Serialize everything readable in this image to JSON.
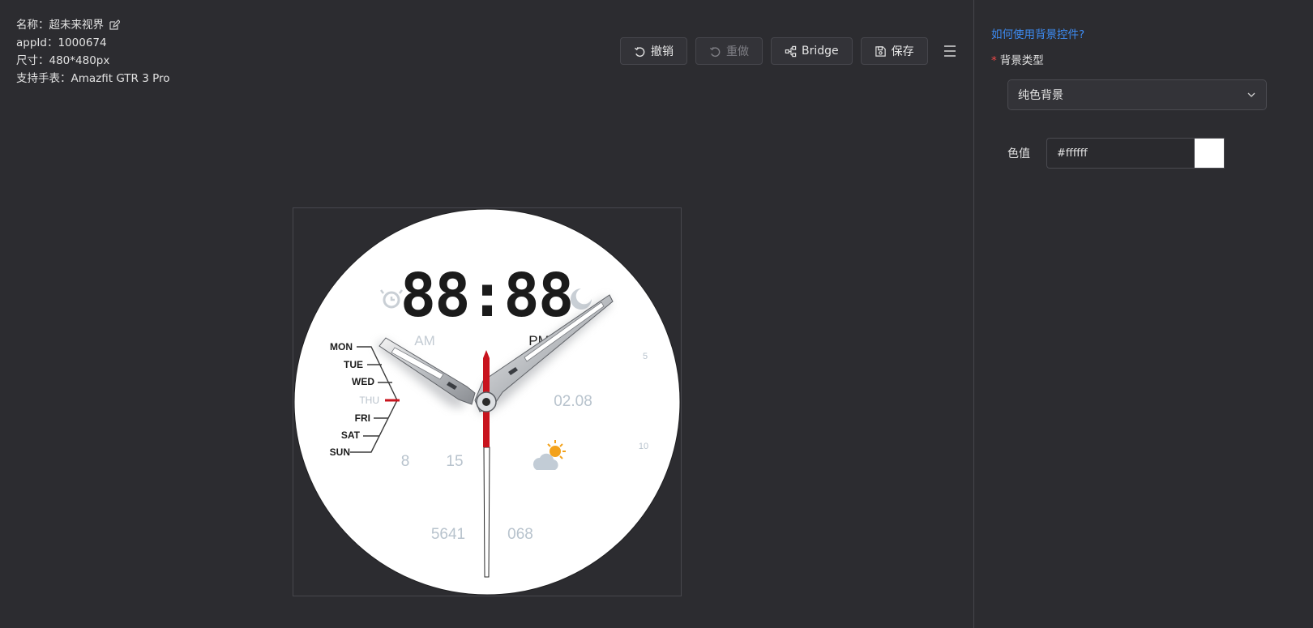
{
  "info": {
    "name": "名称：超未来视界",
    "appid": "appId：1000674",
    "size": "尺寸：480*480px",
    "support": "支持手表：Amazfit GTR 3 Pro"
  },
  "toolbar": {
    "undo_label": "撤销",
    "redo_label": "重做",
    "bridge_label": "Bridge",
    "save_label": "保存"
  },
  "panel": {
    "help_link": "如何使用背景控件?",
    "required_mark": "*",
    "bg_type_label": "背景类型",
    "bg_type_value": "纯色背景",
    "color_label": "色值",
    "color_value": "#ffffff"
  },
  "watch": {
    "time": "88:88",
    "am": "AM",
    "pm": "PM",
    "weekdays": [
      "MON",
      "TUE",
      "WED",
      "THU",
      "FRI",
      "SAT",
      "SUN"
    ],
    "active_weekday": "THU",
    "date": "02.08",
    "left_values": [
      "8",
      "15"
    ],
    "steps": "5641",
    "heart_rate": "068",
    "scale_top": "5",
    "scale_bottom": "10"
  },
  "colors": {
    "background": "#2c2c30",
    "accent_link": "#3d8bf2",
    "required": "#f04848",
    "swatch": "#ffffff",
    "second_hand": "#c8141e"
  },
  "icons": {
    "edit": "edit-icon",
    "undo": "undo-icon",
    "redo": "redo-icon",
    "bridge": "bridge-icon",
    "save": "save-icon",
    "menu": "menu-icon",
    "dropdown": "chevron-down-icon",
    "alarm": "alarm-icon",
    "moon": "moon-icon",
    "weather": "partly-cloudy-icon"
  }
}
